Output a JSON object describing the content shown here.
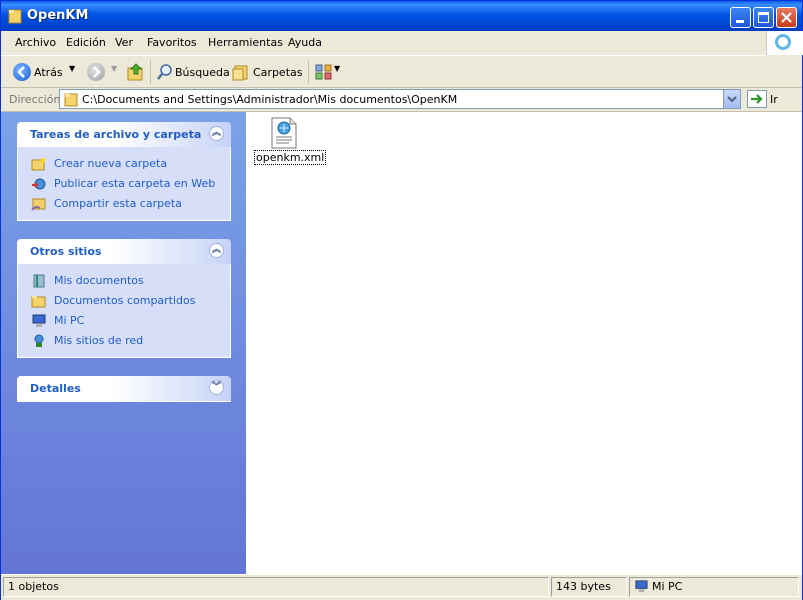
{
  "window": {
    "title": "OpenKM"
  },
  "menu": [
    "Archivo",
    "Edición",
    "Ver",
    "Favoritos",
    "Herramientas",
    "Ayuda"
  ],
  "toolbar": {
    "back_label": "Atrás",
    "search_label": "Búsqueda",
    "folders_label": "Carpetas"
  },
  "address": {
    "label": "Dirección",
    "path": "C:\\Documents and Settings\\Administrador\\Mis documentos\\OpenKM",
    "go_label": "Ir"
  },
  "panels": {
    "tasks": {
      "title": "Tareas de archivo y carpeta",
      "items": [
        "Crear nueva carpeta",
        "Publicar esta carpeta en Web",
        "Compartir esta carpeta"
      ]
    },
    "places": {
      "title": "Otros sitios",
      "items": [
        "Mis documentos",
        "Documentos compartidos",
        "Mi PC",
        "Mis sitios de red"
      ]
    },
    "details": {
      "title": "Detalles"
    }
  },
  "files": [
    {
      "name": "openkm.xml",
      "icon": "xml-file-icon"
    }
  ],
  "status": {
    "objects": "1 objetos",
    "size": "143 bytes",
    "location": "Mi PC"
  },
  "colors": {
    "titlebar": "#0055e5",
    "sidepane": "#6375d6",
    "link": "#215dc6"
  }
}
